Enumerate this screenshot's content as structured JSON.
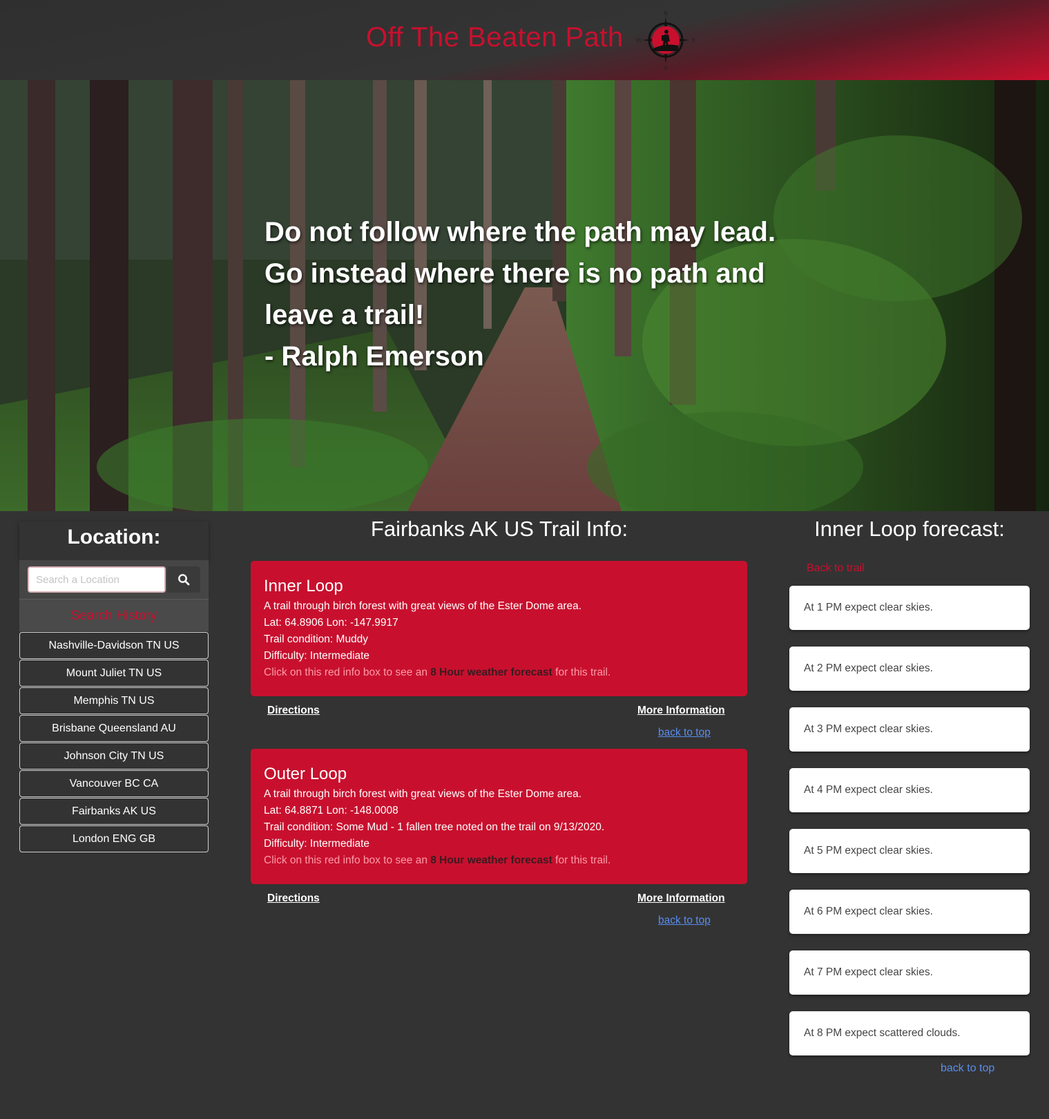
{
  "header": {
    "site_title": "Off The Beaten Path",
    "logo_icon": "compass-hiker-icon"
  },
  "hero": {
    "quote_lines": [
      "Do not follow where the path may lead.",
      "Go instead where there is no path and",
      "leave a trail!",
      "- Ralph Emerson"
    ]
  },
  "location": {
    "heading": "Location:",
    "search_placeholder": "Search a Location",
    "search_icon": "search-icon",
    "history_header": "Search History",
    "history": [
      "Nashville-Davidson TN US",
      "Mount Juliet TN US",
      "Memphis TN US",
      "Brisbane Queensland AU",
      "Johnson City TN US",
      "Vancouver BC CA",
      "Fairbanks AK US",
      "London ENG GB"
    ]
  },
  "trails": {
    "title": "Fairbanks AK US Trail Info:",
    "items": [
      {
        "name": "Inner Loop",
        "description": "A trail through birch forest with great views of the Ester Dome area.",
        "coords": "Lat: 64.8906 Lon: -147.9917",
        "condition": "Trail condition: Muddy",
        "difficulty": "Difficulty: Intermediate",
        "hint_pre": "Click on this red info box to see an ",
        "hint_bold": "8 Hour weather forecast",
        "hint_post": " for this trail.",
        "directions": "Directions",
        "more_info": "More Information",
        "back_to_top": "back to top"
      },
      {
        "name": "Outer Loop",
        "description": "A trail through birch forest with great views of the Ester Dome area.",
        "coords": "Lat: 64.8871 Lon: -148.0008",
        "condition": "Trail condition: Some Mud - 1 fallen tree noted on the trail on 9/13/2020.",
        "difficulty": "Difficulty: Intermediate",
        "hint_pre": "Click on this red info box to see an ",
        "hint_bold": "8 Hour weather forecast",
        "hint_post": " for this trail.",
        "directions": "Directions",
        "more_info": "More Information",
        "back_to_top": "back to top"
      }
    ]
  },
  "forecast": {
    "title": "Inner Loop forecast:",
    "back_to_trail": "Back to trail",
    "items": [
      "At 1 PM expect clear skies.",
      "At 2 PM expect clear skies.",
      "At 3 PM expect clear skies.",
      "At 4 PM expect clear skies.",
      "At 5 PM expect clear skies.",
      "At 6 PM expect clear skies.",
      "At 7 PM expect clear skies.",
      "At 8 PM expect scattered clouds."
    ],
    "back_to_top": "back to top"
  },
  "colors": {
    "brand_red": "#c8102e",
    "background": "#333333",
    "link_blue": "#5a8dee"
  }
}
